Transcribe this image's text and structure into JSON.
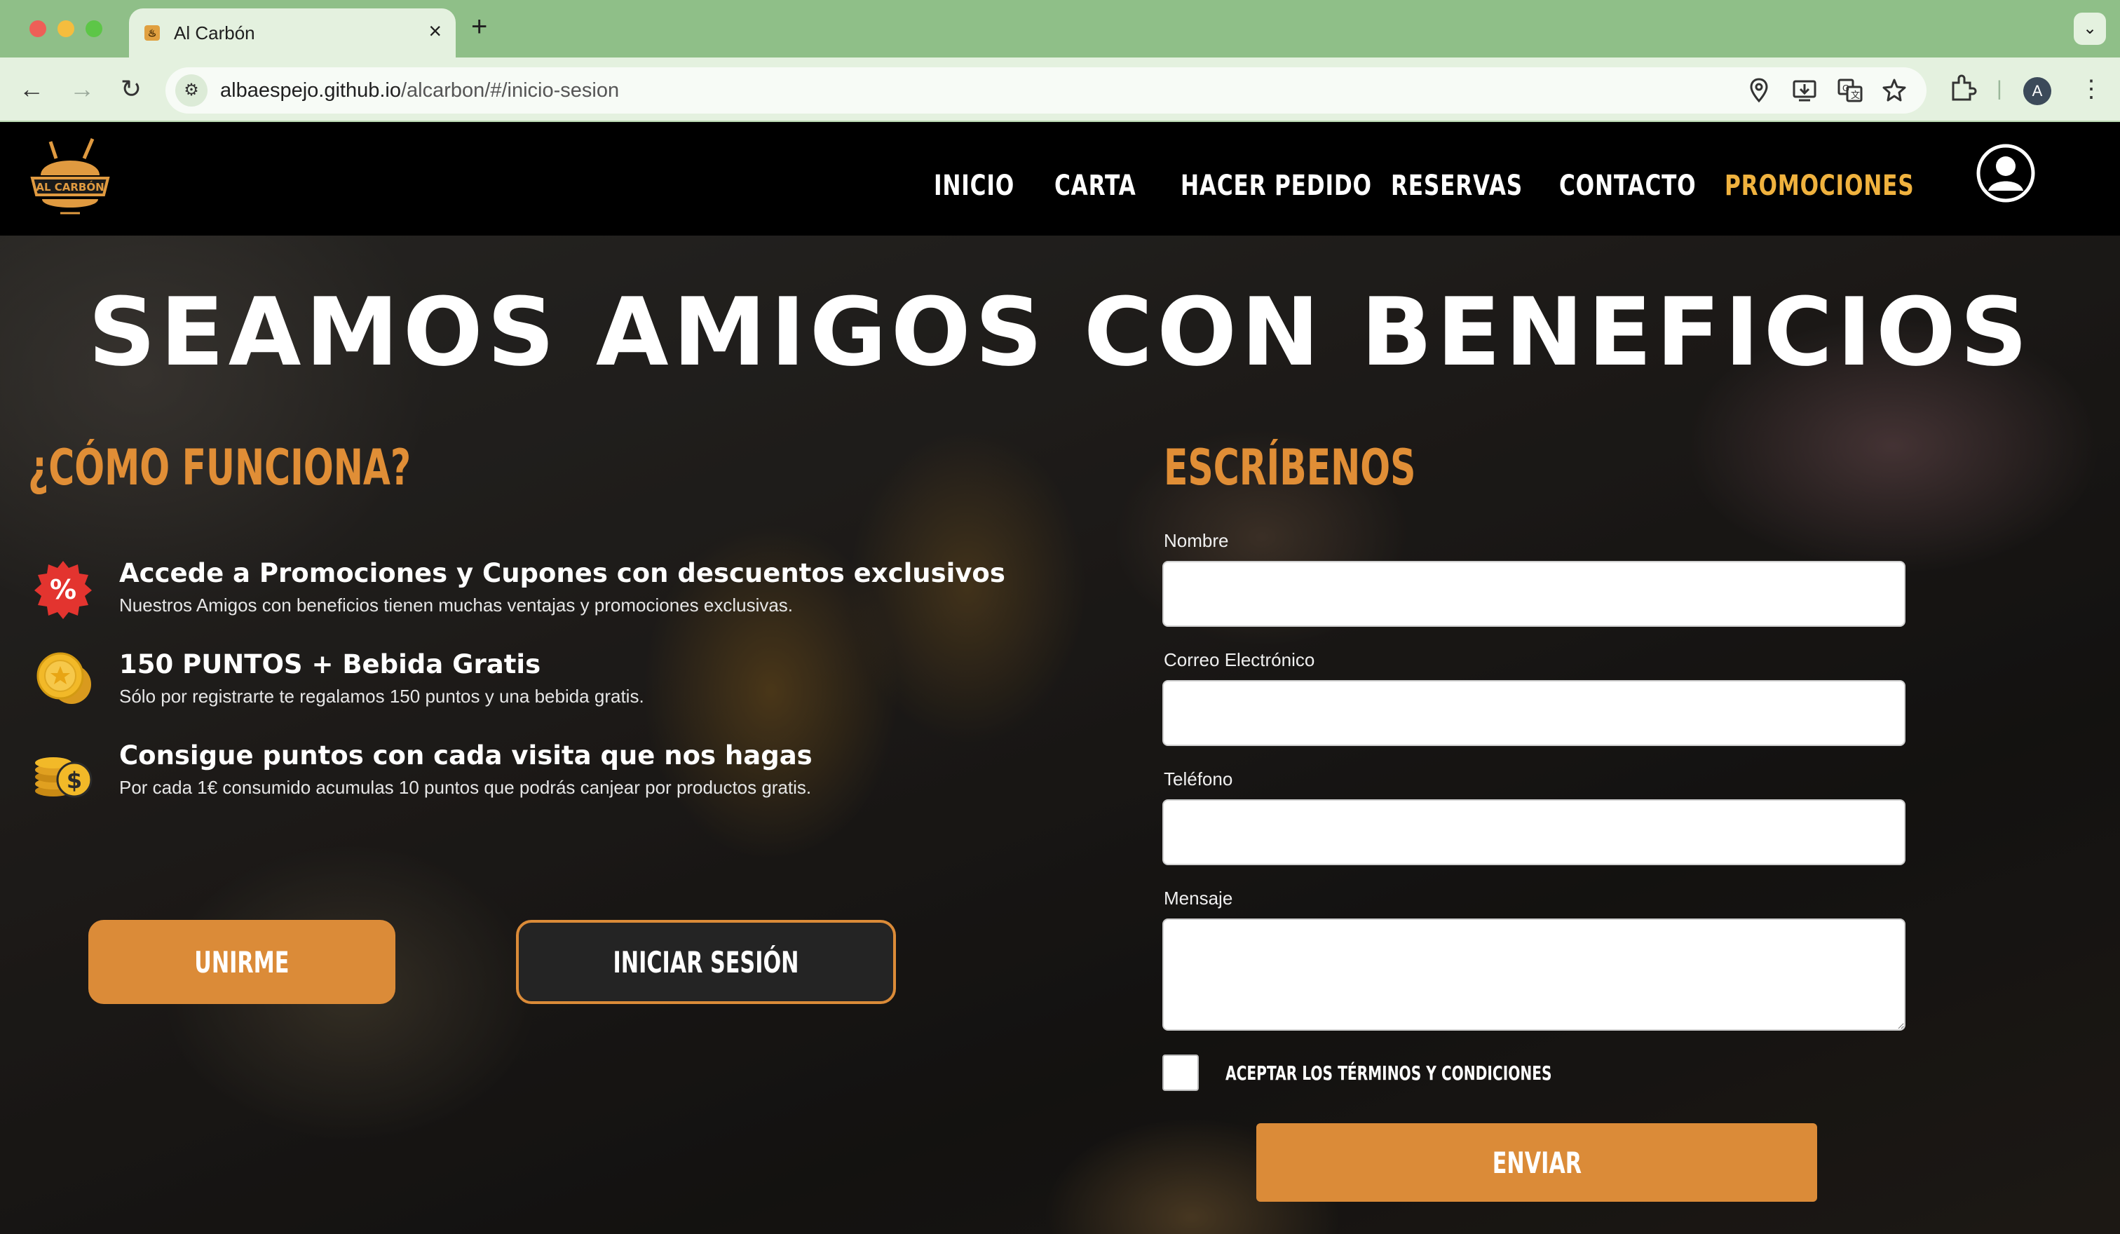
{
  "browser": {
    "tab_title": "Al Carbón",
    "url_host": "albaespejo.github.io",
    "url_path": "/alcarbon/#/inicio-sesion",
    "profile_initial": "A",
    "icons": [
      "back-arrow-icon",
      "forward-arrow-icon",
      "reload-icon",
      "site-info-icon",
      "location-icon",
      "install-app-icon",
      "translate-icon",
      "bookmark-star-icon",
      "extensions-icon",
      "more-menu-icon",
      "tab-close-icon",
      "new-tab-icon",
      "tab-list-icon"
    ]
  },
  "header": {
    "logo_text": "AL CARBÓN",
    "nav": [
      "INICIO",
      "CARTA",
      "HACER PEDIDO",
      "RESERVAS",
      "CONTACTO",
      "PROMOCIONES"
    ],
    "active_nav": "PROMOCIONES"
  },
  "hero": {
    "title": "SEAMOS AMIGOS CON BENEFICIOS"
  },
  "how_it_works": {
    "heading": "¿CÓMO FUNCIONA?",
    "items": [
      {
        "icon": "percent-badge-icon",
        "title": "Accede a Promociones y Cupones con descuentos exclusivos",
        "description": "Nuestros Amigos con beneficios tienen muchas ventajas y promociones exclusivas."
      },
      {
        "icon": "gold-coins-icon",
        "title": "150 PUNTOS + Bebida Gratis",
        "description": "Sólo por registrarte te regalamos 150 puntos y una bebida gratis."
      },
      {
        "icon": "coin-stack-icon",
        "title": "Consigue puntos con cada visita que nos hagas",
        "description": "Por cada 1€ consumido acumulas 10 puntos que podrás canjear por productos gratis."
      }
    ],
    "join_label": "UNIRME",
    "login_label": "INICIAR SESIÓN"
  },
  "contact_form": {
    "heading": "ESCRÍBENOS",
    "name_label": "Nombre",
    "name_value": "",
    "email_label": "Correo Electrónico",
    "email_value": "",
    "phone_label": "Teléfono",
    "phone_value": "",
    "message_label": "Mensaje",
    "message_value": "",
    "terms_label": "ACEPTAR LOS TÉRMINOS Y CONDICIONES",
    "terms_checked": false,
    "submit_label": "ENVIAR"
  },
  "colors": {
    "accent": "#db8b38",
    "nav_active": "#f0b23e",
    "header_bg": "#000000",
    "browser_frame": "#8fbf88"
  }
}
